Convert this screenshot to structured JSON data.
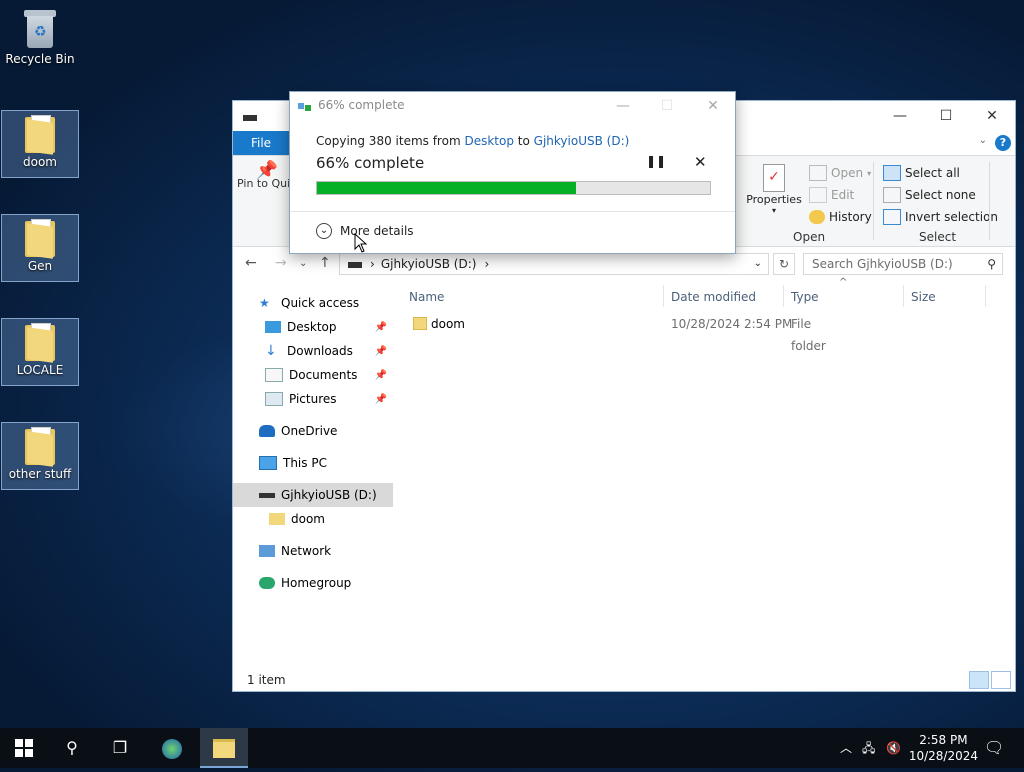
{
  "desktop": {
    "icons": [
      {
        "label": "Recycle Bin"
      },
      {
        "label": "doom"
      },
      {
        "label": "Gen"
      },
      {
        "label": "LOCALE"
      },
      {
        "label": "other stuff"
      }
    ]
  },
  "explorer": {
    "ribbon": {
      "tab_file": "File",
      "pin_label": "Pin to Quick access",
      "properties": "Properties",
      "open_items": [
        "Open",
        "Edit",
        "History"
      ],
      "open_group": "Open",
      "select_items": [
        "Select all",
        "Select none",
        "Invert selection"
      ],
      "select_group": "Select"
    },
    "address": "GjhkyioUSB (D:)",
    "search_placeholder": "Search GjhkyioUSB (D:)",
    "nav": [
      {
        "label": "Quick access",
        "pinned": false
      },
      {
        "label": "Desktop",
        "pinned": true
      },
      {
        "label": "Downloads",
        "pinned": true
      },
      {
        "label": "Documents",
        "pinned": true
      },
      {
        "label": "Pictures",
        "pinned": true
      },
      {
        "label": "OneDrive",
        "pinned": false
      },
      {
        "label": "This PC",
        "pinned": false
      },
      {
        "label": "GjhkyioUSB (D:)",
        "pinned": false
      },
      {
        "label": "doom",
        "pinned": false
      },
      {
        "label": "Network",
        "pinned": false
      },
      {
        "label": "Homegroup",
        "pinned": false
      }
    ],
    "columns": [
      "Name",
      "Date modified",
      "Type",
      "Size"
    ],
    "rows": [
      {
        "name": "doom",
        "date": "10/28/2024 2:54 PM",
        "type": "File folder",
        "size": ""
      }
    ],
    "status": "1 item"
  },
  "copy_dialog": {
    "title": "66% complete",
    "copy_prefix": "Copying 380 items from",
    "source": "Desktop",
    "to": "to",
    "destination": "GjhkyioUSB (D:)",
    "progress_text": "66% complete",
    "progress": 0.66,
    "more_details": "More details"
  },
  "taskbar": {
    "time": "2:58 PM",
    "date": "10/28/2024"
  },
  "colors": {
    "accent": "#1979ca",
    "progress": "#06b025",
    "link": "#1e64b5"
  }
}
